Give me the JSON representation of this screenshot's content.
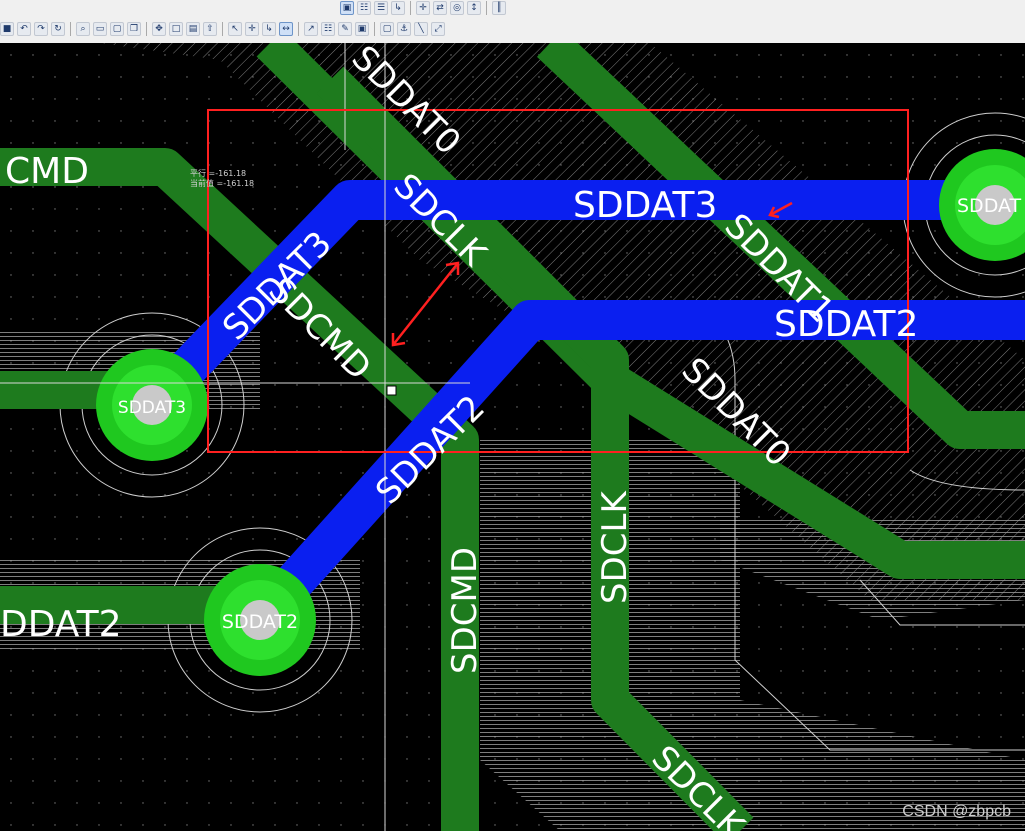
{
  "toolbar": {
    "top_icons": [
      "layer-setup-icon",
      "grid-icon",
      "list-icon",
      "route-icon",
      "move-icon",
      "link-icon",
      "via-icon",
      "height-icon",
      "split-icon"
    ],
    "bottom_icons": [
      "save-icon",
      "undo-icon",
      "redo-icon",
      "refresh-icon",
      "zoom-icon",
      "view-icon",
      "select-icon",
      "copy-icon",
      "pan-icon",
      "board-icon",
      "layers-icon",
      "export-icon",
      "pointer-icon",
      "move-icon",
      "route-icon",
      "measure-icon",
      "select-area-icon",
      "grid-icon",
      "pen-icon",
      "lock-icon",
      "unlock-icon",
      "anchor-icon",
      "trace-icon",
      "stretch-icon"
    ]
  },
  "pcb": {
    "colors": {
      "background": "#000000",
      "top_trace": "#1e7b1e",
      "bottom_trace": "#0a1ff0",
      "copper_pour_lines": "#b9b9b9",
      "pad_outer": "#1fc81f",
      "pad_inner": "#c9c9c9",
      "measure": "#ff2020",
      "label": "#ffffff"
    },
    "labels": {
      "sdcmd_left": "CMD",
      "sddat0_top": "SDDAT0",
      "sdclk_diag": "SDCLK",
      "sddat3_right": "SDDAT3",
      "sddat1": "SDDAT1",
      "sddat2_right": "SDDAT2",
      "sddat3_left_blue": "SDDAT3",
      "sdcmd_diag": "SDCMD",
      "sddat0_mid": "SDDAT0",
      "sddat2_blue": "SDDAT2",
      "sdclk_vertical": "SDCLK",
      "sdcmd_vertical": "SDCMD",
      "sddat2_left": "DDAT2",
      "sdclk_bottom": "SDCLK",
      "pad_sddat3": "SDDAT3",
      "pad_sddat2": "SDDAT2",
      "pad_sddat_right": "SDDAT"
    },
    "measurement_tooltip": {
      "line1": "平行 =-161.18",
      "line2": "当前值 =-161.18"
    },
    "watermark": "CSDN @zbpcb"
  }
}
